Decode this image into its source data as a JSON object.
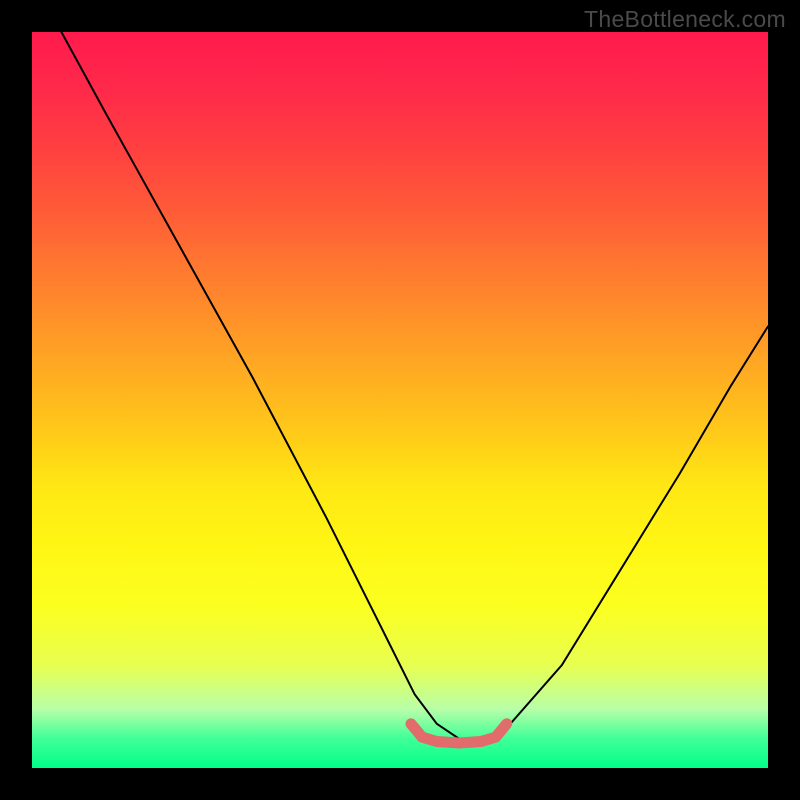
{
  "watermark": "TheBottleneck.com",
  "chart_data": {
    "type": "line",
    "title": "",
    "xlabel": "",
    "ylabel": "",
    "xlim": [
      0,
      100
    ],
    "ylim": [
      0,
      100
    ],
    "note": "Axes unlabeled in source image. Values are read as percent of plot width (x) and percent of plot height from bottom (y). Background gradient red-to-green encodes score from worst (top) to best (bottom).",
    "series": [
      {
        "name": "black-curve",
        "color": "#000000",
        "x": [
          4,
          10,
          20,
          30,
          40,
          48,
          52,
          55,
          58,
          62,
          65,
          72,
          80,
          88,
          95,
          100
        ],
        "y": [
          100,
          89,
          71,
          53,
          34,
          18,
          10,
          6,
          4,
          4,
          6,
          14,
          27,
          40,
          52,
          60
        ]
      },
      {
        "name": "red-flat-segment",
        "color": "#e26b6b",
        "x": [
          51.5,
          53,
          55,
          58,
          61,
          63,
          64.5
        ],
        "y": [
          6,
          4.2,
          3.6,
          3.4,
          3.6,
          4.2,
          6
        ]
      }
    ]
  }
}
